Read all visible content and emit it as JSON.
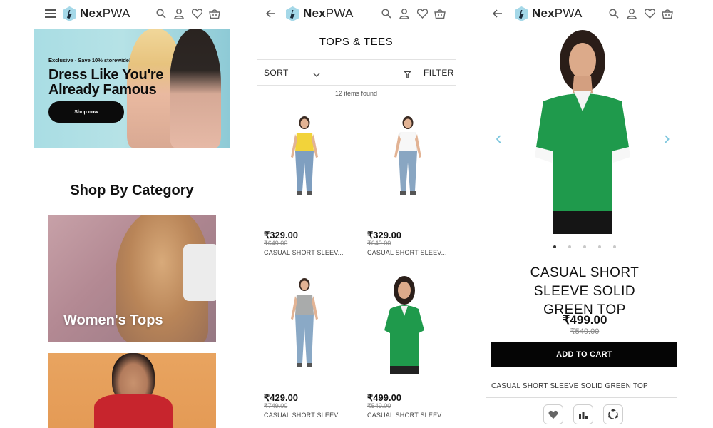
{
  "brand": {
    "name_bold": "Nex",
    "name_light": "PWA"
  },
  "home": {
    "hero": {
      "kicker": "Exclusive - Save 10% storewide!",
      "title": "Dress Like You're Already Famous",
      "button": "Shop now"
    },
    "section_title": "Shop By Category",
    "categories": [
      {
        "label": "Women's Tops"
      },
      {
        "label": ""
      }
    ]
  },
  "listing": {
    "title": "TOPS & TEES",
    "sort_label": "SORT",
    "filter_label": "FILTER",
    "items_found": "12 items found",
    "products": [
      {
        "price": "₹329.00",
        "mrp": "₹649.00",
        "name": "CASUAL SHORT SLEEV...",
        "shirt_color": "#f2d33a"
      },
      {
        "price": "₹329.00",
        "mrp": "₹649.00",
        "name": "CASUAL SHORT SLEEV...",
        "shirt_color": "#f7f7f7"
      },
      {
        "price": "₹429.00",
        "mrp": "₹749.00",
        "name": "CASUAL SHORT SLEEV...",
        "shirt_color": "#a9abab"
      },
      {
        "price": "₹499.00",
        "mrp": "₹549.00",
        "name": "CASUAL SHORT SLEEV...",
        "shirt_color": "#1f9a4c"
      }
    ]
  },
  "product": {
    "title": "CASUAL SHORT SLEEVE SOLID GREEN TOP",
    "price": "₹499.00",
    "mrp": "₹549.00",
    "add_to_cart": "ADD TO CART",
    "description_title": "CASUAL SHORT SLEEVE SOLID GREEN TOP",
    "carousel_count": 5,
    "carousel_active": 1
  },
  "colors": {
    "accent_arrow": "#7ec7de",
    "button_black": "#050505",
    "product_green": "#1f9a4c"
  }
}
